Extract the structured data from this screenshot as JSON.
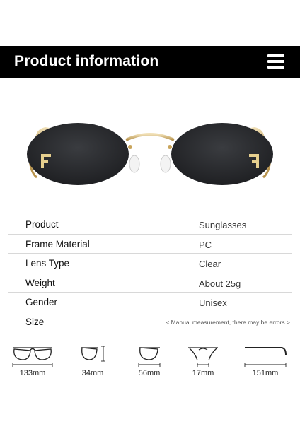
{
  "header": {
    "title": "Product information",
    "menu_icon": "hamburger-menu-icon"
  },
  "specs": [
    {
      "label": "Product",
      "value": "Sunglasses"
    },
    {
      "label": "Frame Material",
      "value": "PC"
    },
    {
      "label": "Lens Type",
      "value": "Clear"
    },
    {
      "label": "Weight",
      "value": "About 25g"
    },
    {
      "label": "Gender",
      "value": "Unisex"
    },
    {
      "label": "Size",
      "value": "< Manual measurement, there may be errors >"
    }
  ],
  "sizes": [
    {
      "value": "133mm",
      "icon": "frame-width-icon"
    },
    {
      "value": "34mm",
      "icon": "lens-height-icon"
    },
    {
      "value": "56mm",
      "icon": "lens-width-icon"
    },
    {
      "value": "17mm",
      "icon": "bridge-width-icon"
    },
    {
      "value": "151mm",
      "icon": "temple-length-icon"
    }
  ],
  "colors": {
    "header_bg": "#000000",
    "lens": "#2b2d31",
    "frame": "#c9a55c"
  }
}
